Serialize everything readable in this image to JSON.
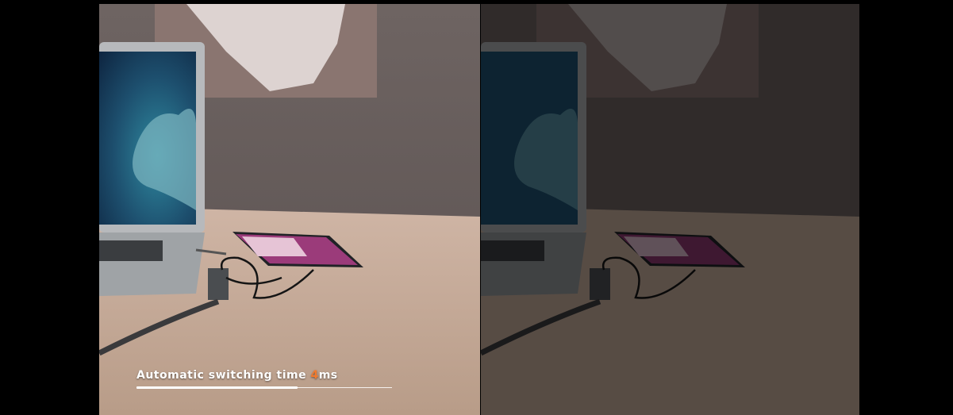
{
  "caption": {
    "prefix": "Automatic switching time ",
    "value": "4",
    "unit": "ms"
  },
  "progress": {
    "fraction": 0.63
  },
  "colors": {
    "accent": "#f07a2e",
    "caption_text": "#ffffff",
    "background": "#000000"
  }
}
